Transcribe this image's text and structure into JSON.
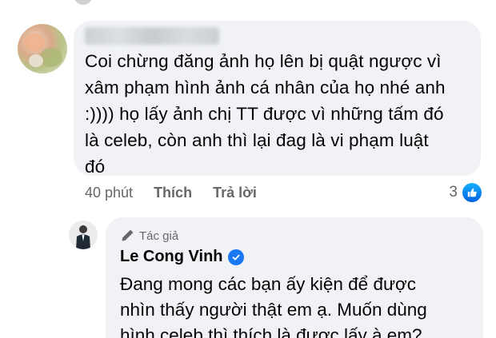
{
  "comment": {
    "lines": [
      "Coi chừng đăng ảnh họ lên bị quật ngược vì",
      "xâm phạm hình ảnh cá nhân của họ nhé anh",
      ":)))) họ lấy ảnh chị TT được vì những tấm đó",
      "là celeb, còn anh thì lại đag là vi phạm luật",
      "đó"
    ],
    "time": "40 phút",
    "like_label": "Thích",
    "reply_label": "Trả lời",
    "reaction_count": "3",
    "reaction_icon": "like-icon",
    "accent_color": "#1877f2"
  },
  "reply": {
    "badge_label": "Tác giả",
    "badge_icon": "pencil-icon",
    "author": "Le Cong Vinh",
    "verified_icon": "verified-badge-icon",
    "lines": [
      "Đang mong các bạn ấy kiện để được",
      "nhìn thấy người thật em ạ. Muốn dùng",
      "hình celeb thì thích là được lấy à em?"
    ]
  }
}
